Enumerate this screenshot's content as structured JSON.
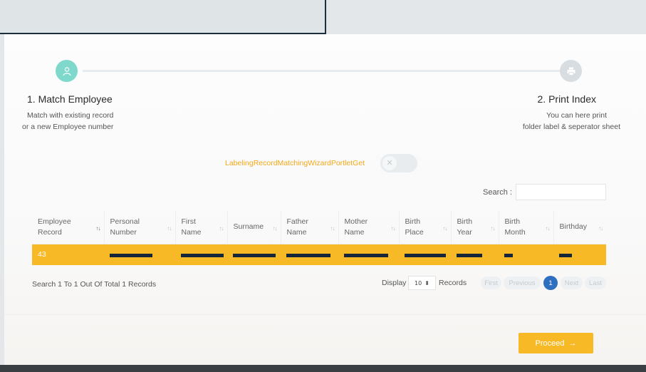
{
  "wizard": {
    "steps": [
      {
        "title": "1. Match Employee",
        "desc1": "Match with existing record",
        "desc2": "or a new Employee number",
        "icon": "user-icon"
      },
      {
        "title": "2. Print Index",
        "desc1": "You can here print",
        "desc2": "folder label & seperator sheet",
        "icon": "printer-icon"
      }
    ]
  },
  "portlet_label": "LabelingRecordMatchingWizardPortletGet",
  "toggle": {
    "icon": "close-icon",
    "state": "off"
  },
  "search": {
    "label": "Search :",
    "value": ""
  },
  "table": {
    "headers": [
      [
        "Employee",
        "Record"
      ],
      [
        "Personal",
        "Number"
      ],
      [
        "First",
        "Name"
      ],
      [
        "Surname",
        ""
      ],
      [
        "Father",
        "Name"
      ],
      [
        "Mother",
        "Name"
      ],
      [
        "Birth",
        "Place"
      ],
      [
        "Birth",
        "Year"
      ],
      [
        "Birth",
        "Month"
      ],
      [
        "Birthday",
        ""
      ]
    ],
    "rows": [
      {
        "employee_record": "43"
      }
    ]
  },
  "info": "Search 1 To 1 Out Of Total 1 Records",
  "pagination": {
    "display_label": "Display",
    "page_size": "10",
    "records_label": "Records",
    "first": "First",
    "previous": "Previous",
    "current": "1",
    "next": "Next",
    "last": "Last"
  },
  "proceed": {
    "label": "Proceed",
    "arrow": "→"
  },
  "colors": {
    "accent": "#f7b926",
    "teal": "#7fd8cc",
    "primary": "#2e6fc0"
  }
}
